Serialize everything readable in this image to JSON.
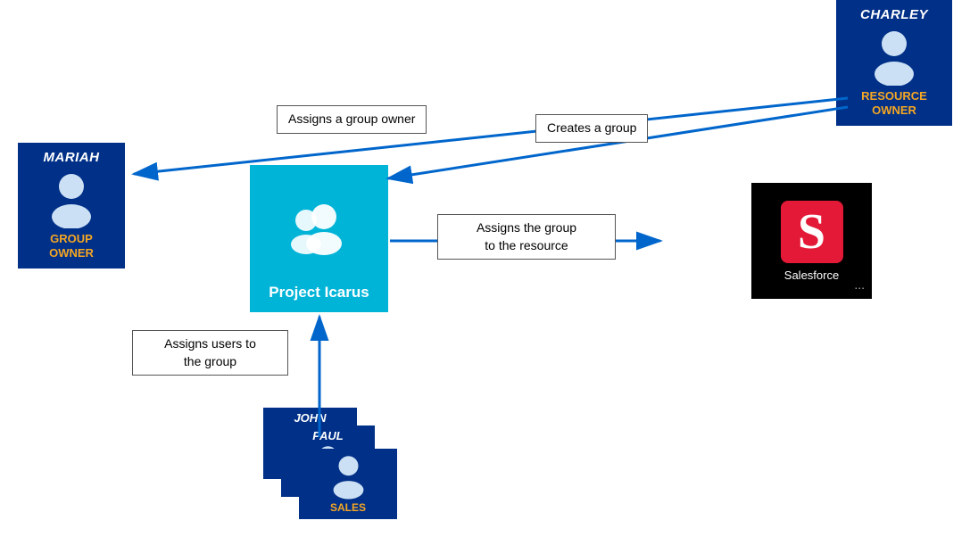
{
  "charley": {
    "name": "CHARLEY",
    "role": "RESOURCE\nOWNER"
  },
  "mariah": {
    "name": "MARIAH",
    "role": "GROUP\nOWNER"
  },
  "group": {
    "name": "Project Icarus"
  },
  "salesforce": {
    "label": "Salesforce",
    "dots": "..."
  },
  "labels": {
    "assigns_group_owner": "Assigns a group owner",
    "creates_group": "Creates a group",
    "assigns_group_resource": "Assigns the group\nto the resource",
    "assigns_users": "Assigns users to\nthe group"
  },
  "users": [
    {
      "name": "JOHN"
    },
    {
      "name": "PAUL"
    },
    {
      "name": "SALES",
      "role": ""
    }
  ]
}
